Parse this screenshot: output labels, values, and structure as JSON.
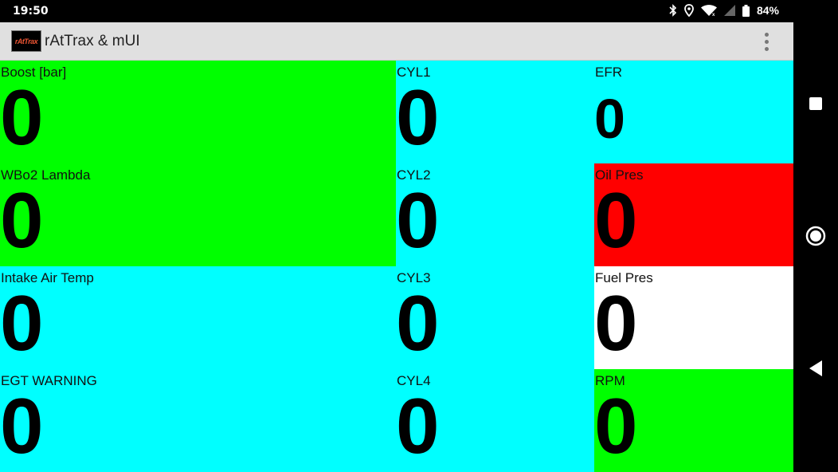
{
  "status_bar": {
    "time": "19:50",
    "battery": "84%",
    "icons": [
      "bluetooth-icon",
      "location-icon",
      "wifi-icon",
      "signal-icon",
      "battery-icon"
    ]
  },
  "app_bar": {
    "logo_text": "rAtTrax",
    "title": "rAtTrax & mUI",
    "menu_icon": "overflow-menu-icon"
  },
  "colors": {
    "green": "#00ff00",
    "cyan": "#00ffff",
    "red": "#ff0000",
    "white": "#ffffff"
  },
  "tiles": [
    {
      "label": "Boost [bar]",
      "value": "0",
      "color": "#00ff00"
    },
    {
      "label": "WBo2 Lambda",
      "value": "0",
      "color": "#00ff00"
    },
    {
      "label": "Intake Air Temp",
      "value": "0",
      "color": "#00ffff"
    },
    {
      "label": "EGT WARNING",
      "value": "0",
      "color": "#00ffff"
    },
    {
      "label": "CYL1",
      "value": "0",
      "color": "#00ffff"
    },
    {
      "label": "CYL2",
      "value": "0",
      "color": "#00ffff"
    },
    {
      "label": "CYL3",
      "value": "0",
      "color": "#00ffff"
    },
    {
      "label": "CYL4",
      "value": "0",
      "color": "#00ffff"
    },
    {
      "label": "EFR",
      "value": "0",
      "color": "#00ffff"
    },
    {
      "label": "Oil Pres",
      "value": "0",
      "color": "#ff0000"
    },
    {
      "label": "Fuel Pres",
      "value": "0",
      "color": "#ffffff"
    },
    {
      "label": "RPM",
      "value": "0",
      "color": "#00ff00"
    }
  ],
  "nav_bar": {
    "buttons": [
      "recents-icon",
      "home-icon",
      "back-icon"
    ]
  }
}
